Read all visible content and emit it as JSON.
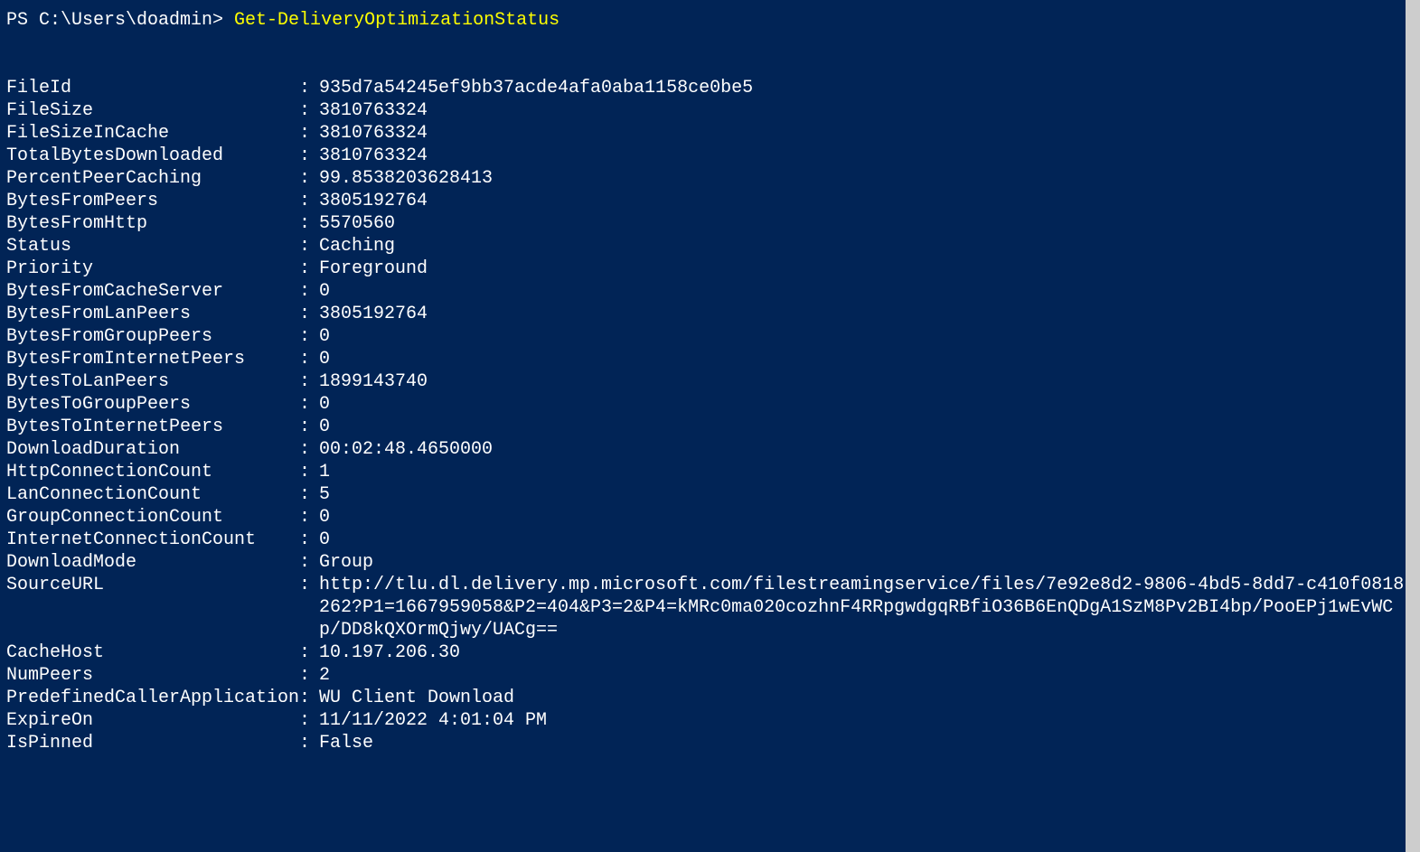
{
  "prompt": {
    "prefix": "PS C:\\Users\\doadmin> ",
    "command": "Get-DeliveryOptimizationStatus"
  },
  "separator": ":",
  "rows": [
    {
      "key": "FileId",
      "value": "935d7a54245ef9bb37acde4afa0aba1158ce0be5"
    },
    {
      "key": "FileSize",
      "value": "3810763324"
    },
    {
      "key": "FileSizeInCache",
      "value": "3810763324"
    },
    {
      "key": "TotalBytesDownloaded",
      "value": "3810763324"
    },
    {
      "key": "PercentPeerCaching",
      "value": "99.8538203628413"
    },
    {
      "key": "BytesFromPeers",
      "value": "3805192764"
    },
    {
      "key": "BytesFromHttp",
      "value": "5570560"
    },
    {
      "key": "Status",
      "value": "Caching"
    },
    {
      "key": "Priority",
      "value": "Foreground"
    },
    {
      "key": "BytesFromCacheServer",
      "value": "0"
    },
    {
      "key": "BytesFromLanPeers",
      "value": "3805192764"
    },
    {
      "key": "BytesFromGroupPeers",
      "value": "0"
    },
    {
      "key": "BytesFromInternetPeers",
      "value": "0"
    },
    {
      "key": "BytesToLanPeers",
      "value": "1899143740"
    },
    {
      "key": "BytesToGroupPeers",
      "value": "0"
    },
    {
      "key": "BytesToInternetPeers",
      "value": "0"
    },
    {
      "key": "DownloadDuration",
      "value": "00:02:48.4650000"
    },
    {
      "key": "HttpConnectionCount",
      "value": "1"
    },
    {
      "key": "LanConnectionCount",
      "value": "5"
    },
    {
      "key": "GroupConnectionCount",
      "value": "0"
    },
    {
      "key": "InternetConnectionCount",
      "value": "0"
    },
    {
      "key": "DownloadMode",
      "value": "Group"
    },
    {
      "key": "SourceURL",
      "value": "http://tlu.dl.delivery.mp.microsoft.com/filestreamingservice/files/7e92e8d2-9806-4bd5-8dd7-c410f0818262?P1=1667959058&P2=404&P3=2&P4=kMRc0ma020cozhnF4RRpgwdgqRBfiO36B6EnQDgA1SzM8Pv2BI4bp/PooEPj1wEvWCp/DD8kQXOrmQjwy/UACg=="
    },
    {
      "key": "CacheHost",
      "value": "10.197.206.30"
    },
    {
      "key": "NumPeers",
      "value": "2"
    },
    {
      "key": "PredefinedCallerApplication",
      "value": "WU Client Download"
    },
    {
      "key": "ExpireOn",
      "value": "11/11/2022 4:01:04 PM"
    },
    {
      "key": "IsPinned",
      "value": "False"
    }
  ]
}
